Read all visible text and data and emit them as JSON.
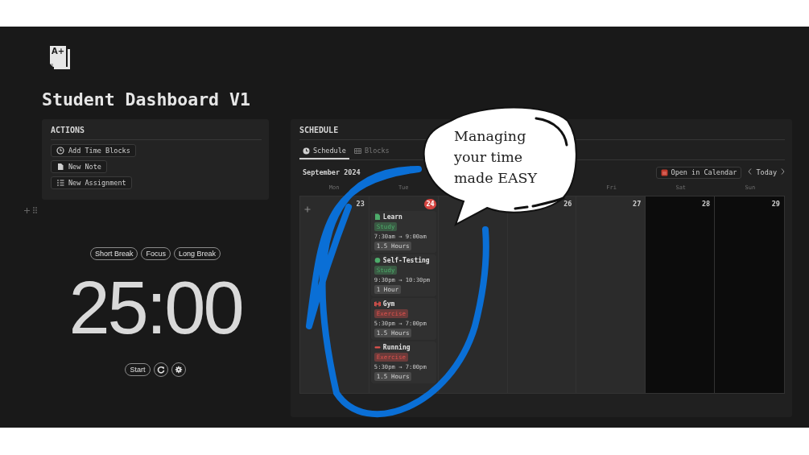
{
  "logo_text": "A+",
  "title": "Student Dashboard V1",
  "actions": {
    "heading": "ACTIONS",
    "buttons": [
      "Add Time Blocks",
      "New Note",
      "New Assignment"
    ]
  },
  "timer": {
    "modes": [
      "Short Break",
      "Focus",
      "Long Break"
    ],
    "time": "25:00",
    "start": "Start"
  },
  "schedule": {
    "heading": "SCHEDULE",
    "tabs": [
      {
        "label": "Schedule",
        "selected": true
      },
      {
        "label": "Blocks",
        "selected": false
      }
    ],
    "month": "September 2024",
    "open_button": "Open in Calendar",
    "today_button": "Today",
    "days": [
      {
        "weekday": "Mon",
        "date": "23",
        "today": false,
        "weekend": false,
        "hovered": true
      },
      {
        "weekday": "Tue",
        "date": "24",
        "today": true,
        "weekend": false,
        "hovered": false,
        "events": [
          {
            "title": "Learn",
            "tag": "Study",
            "color": "#4dab6a",
            "time": "7:30am → 9:00am",
            "duration": "1.5 Hours"
          },
          {
            "title": "Self-Testing",
            "tag": "Study",
            "color": "#4dab6a",
            "time": "9:30pm → 10:30pm",
            "duration": "1 Hour"
          },
          {
            "title": "Gym",
            "tag": "Exercise",
            "color": "#e0524d",
            "time": "5:30pm → 7:00pm",
            "duration": "1.5 Hours"
          },
          {
            "title": "Running",
            "tag": "Exercise",
            "color": "#e0524d",
            "time": "5:30pm → 7:00pm",
            "duration": "1.5 Hours"
          }
        ]
      },
      {
        "today": false,
        "weekend": false,
        "hovered": false
      },
      {
        "date": "26",
        "today": false,
        "weekend": false,
        "hovered": false
      },
      {
        "weekday": "Fri",
        "date": "27",
        "today": false,
        "weekend": false,
        "hovered": false
      },
      {
        "weekday": "Sat",
        "date": "28",
        "today": false,
        "weekend": true,
        "hovered": false
      },
      {
        "weekday": "Sun",
        "date": "29",
        "today": false,
        "weekend": true,
        "hovered": false
      }
    ]
  },
  "callout": {
    "text": "Managing\nyour time\nmade EASY"
  }
}
